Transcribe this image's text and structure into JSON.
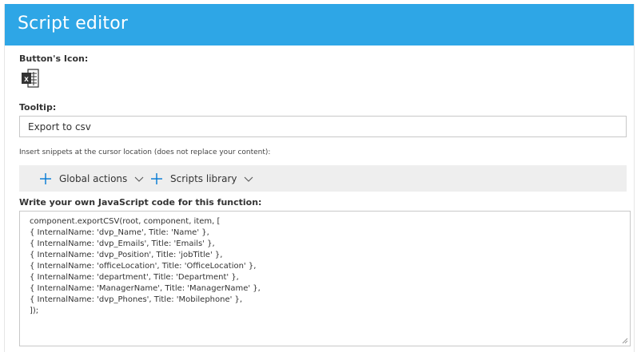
{
  "dialog": {
    "title": "Script editor"
  },
  "icon_section": {
    "label": "Button's Icon:",
    "icon": "excel-csv-export-icon"
  },
  "tooltip_section": {
    "label": "Tooltip:",
    "value": "Export to csv"
  },
  "snippets": {
    "hint": "Insert snippets at the cursor location (does not replace your content):",
    "buttons": [
      {
        "label": "Global actions",
        "icon": "plus-icon"
      },
      {
        "label": "Scripts library",
        "icon": "plus-icon"
      }
    ]
  },
  "code_section": {
    "label": "Write your own JavaScript code for this function:",
    "lines": [
      "component.exportCSV(root, component, item, [",
      "{ InternalName: 'dvp_Name', Title: 'Name' },",
      "{ InternalName: 'dvp_Emails', Title: 'Emails' },",
      "{ InternalName: 'dvp_Position', Title: 'jobTitle' },",
      "{ InternalName: 'officeLocation', Title: 'OfficeLocation' },",
      "{ InternalName: 'department', Title: 'Department' },",
      "{ InternalName: 'ManagerName', Title: 'ManagerName' },",
      "{ InternalName: 'dvp_Phones', Title: 'Mobilephone' },",
      "]);"
    ]
  },
  "colors": {
    "header": "#2ea6e6",
    "accent": "#0078d4",
    "toolbar_bg": "#eeeeee"
  }
}
